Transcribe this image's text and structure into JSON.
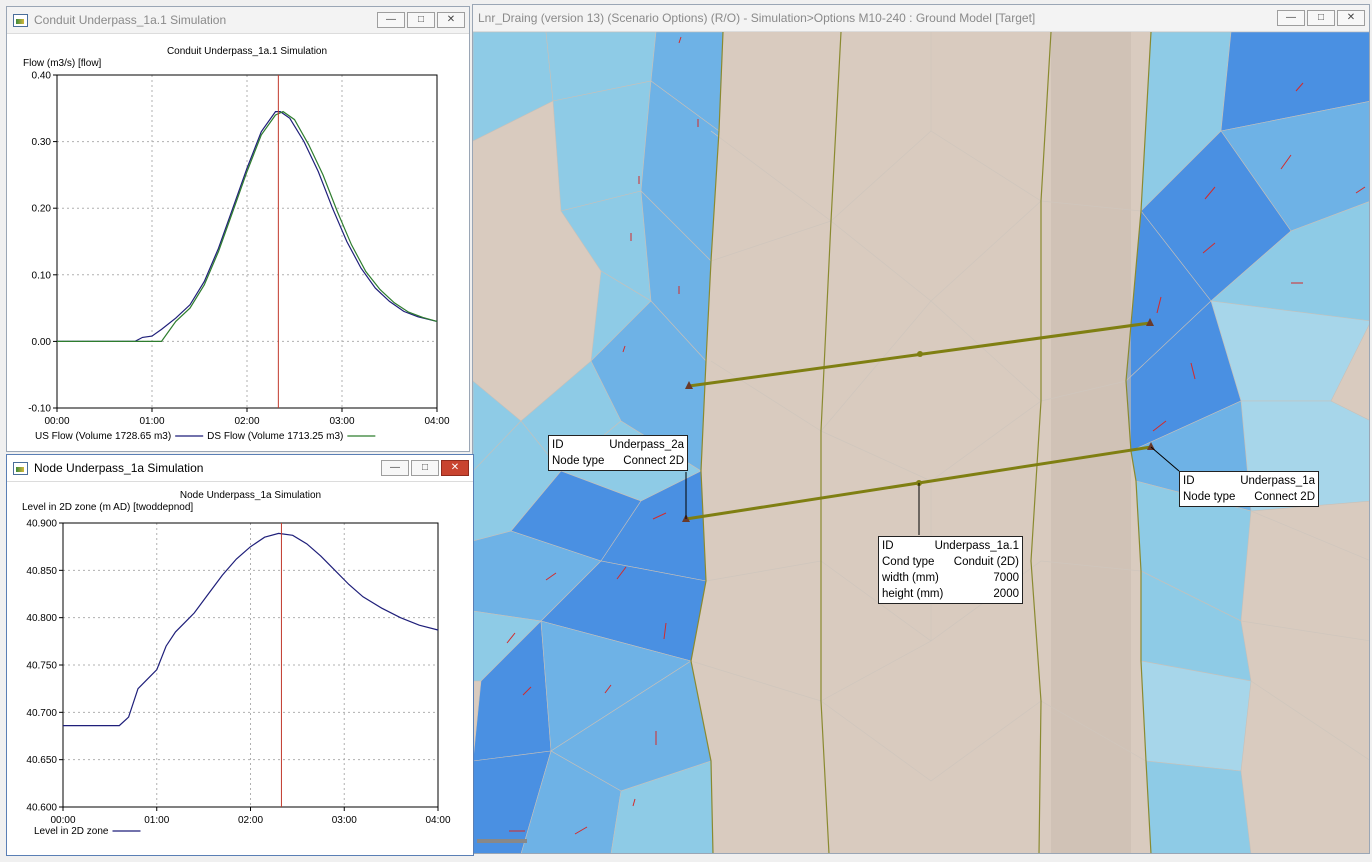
{
  "map_window": {
    "title": "Lnr_Draing (version 13) (Scenario Options) (R/O) - Simulation>Options M10-240 : Ground Model [Target]",
    "tooltips": {
      "node_2a": {
        "id_label": "ID",
        "id_value": "Underpass_2a",
        "type_label": "Node type",
        "type_value": "Connect 2D"
      },
      "node_1a": {
        "id_label": "ID",
        "id_value": "Underpass_1a",
        "type_label": "Node type",
        "type_value": "Connect 2D"
      },
      "conduit": {
        "id_label": "ID",
        "id_value": "Underpass_1a.1",
        "ct_label": "Cond type",
        "ct_value": "Conduit (2D)",
        "w_label": "width (mm)",
        "w_value": "7000",
        "h_label": "height (mm)",
        "h_value": "2000"
      }
    },
    "colors": {
      "ground": "#d9cbbf",
      "water_light": "#8ecbe6",
      "water_mid": "#6eb2e6",
      "water_dark": "#4a90e2",
      "link": "#7f7f12"
    }
  },
  "conduit_window": {
    "title": "Conduit Underpass_1a.1 Simulation",
    "chart_data": {
      "type": "line",
      "title": "Conduit Underpass_1a.1 Simulation",
      "ylabel": "Flow (m3/s) [flow]",
      "ylim": [
        -0.1,
        0.4
      ],
      "yticks": [
        "0.40",
        "0.30",
        "0.20",
        "0.10",
        "0.00",
        "-0.10"
      ],
      "xticks": [
        "00:00",
        "01:00",
        "02:00",
        "03:00",
        "04:00"
      ],
      "xlim_hours": [
        0,
        4
      ],
      "cursor_time_hours": 2.33,
      "series": [
        {
          "name": "US Flow (Volume 1728.65 m3)",
          "color": "#1f1f7a",
          "x": [
            0,
            0.82,
            0.9,
            1.0,
            1.1,
            1.25,
            1.4,
            1.55,
            1.7,
            1.85,
            2.0,
            2.15,
            2.3,
            2.35,
            2.45,
            2.6,
            2.75,
            2.9,
            3.05,
            3.2,
            3.35,
            3.5,
            3.65,
            3.8,
            4.0
          ],
          "y": [
            0,
            0,
            0.006,
            0.008,
            0.018,
            0.035,
            0.055,
            0.09,
            0.14,
            0.2,
            0.26,
            0.315,
            0.345,
            0.345,
            0.335,
            0.3,
            0.255,
            0.2,
            0.15,
            0.11,
            0.08,
            0.06,
            0.045,
            0.037,
            0.03
          ]
        },
        {
          "name": "DS Flow (Volume 1713.25 m3)",
          "color": "#2e7d2e",
          "x": [
            0,
            1.1,
            1.25,
            1.4,
            1.55,
            1.7,
            1.85,
            2.0,
            2.15,
            2.3,
            2.38,
            2.5,
            2.65,
            2.8,
            2.95,
            3.1,
            3.25,
            3.4,
            3.55,
            3.7,
            3.85,
            4.0
          ],
          "y": [
            0,
            0,
            0.03,
            0.05,
            0.085,
            0.135,
            0.195,
            0.255,
            0.31,
            0.34,
            0.345,
            0.333,
            0.295,
            0.25,
            0.195,
            0.145,
            0.105,
            0.078,
            0.058,
            0.044,
            0.036,
            0.03
          ]
        }
      ]
    }
  },
  "node_window": {
    "title": "Node Underpass_1a Simulation",
    "chart_data": {
      "type": "line",
      "title": "Node Underpass_1a Simulation",
      "ylabel": "Level in 2D zone (m AD) [twoddepnod]",
      "ylim": [
        40.6,
        40.9
      ],
      "yticks": [
        "40.900",
        "40.850",
        "40.800",
        "40.750",
        "40.700",
        "40.650",
        "40.600"
      ],
      "xticks": [
        "00:00",
        "01:00",
        "02:00",
        "03:00",
        "04:00"
      ],
      "xlim_hours": [
        0,
        4
      ],
      "cursor_time_hours": 2.33,
      "series": [
        {
          "name": "Level in 2D zone",
          "color": "#1f1f7a",
          "x": [
            0,
            0.6,
            0.7,
            0.8,
            0.9,
            1.0,
            1.1,
            1.2,
            1.3,
            1.4,
            1.55,
            1.7,
            1.85,
            2.0,
            2.15,
            2.3,
            2.45,
            2.6,
            2.75,
            2.9,
            3.05,
            3.2,
            3.4,
            3.6,
            3.8,
            4.0
          ],
          "y": [
            40.686,
            40.686,
            40.695,
            40.725,
            40.735,
            40.745,
            40.77,
            40.785,
            40.795,
            40.805,
            40.825,
            40.845,
            40.862,
            40.875,
            40.885,
            40.889,
            40.887,
            40.878,
            40.865,
            40.85,
            40.835,
            40.822,
            40.81,
            40.8,
            40.792,
            40.787
          ]
        }
      ]
    }
  }
}
